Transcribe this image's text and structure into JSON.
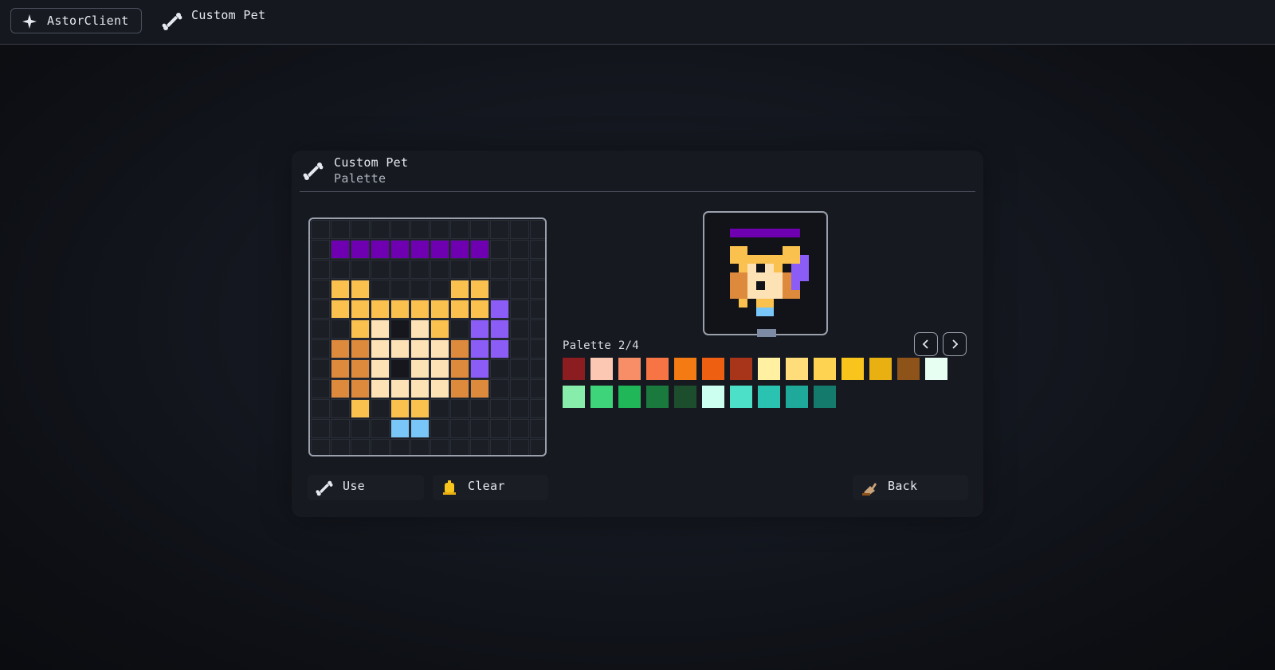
{
  "topbar": {
    "client_label": "AstorClient",
    "client_icon": "sparkle-icon",
    "breadcrumb_label": "Custom Pet",
    "breadcrumb_icon": "bone-icon"
  },
  "panel": {
    "title": "Custom Pet",
    "subtitle": "Palette",
    "icon": "bone-icon"
  },
  "palette": {
    "label": "Palette 2/4",
    "prev_icon": "chevron-left-icon",
    "next_icon": "chevron-right-icon",
    "colors": [
      "#8b1d20",
      "#fcc8b4",
      "#f88e67",
      "#f77545",
      "#f47a14",
      "#ef5f12",
      "#a8341a",
      "#fff0a2",
      "#fedd7a",
      "#fed352",
      "#f9c51c",
      "#e9b012",
      "#8e5318",
      "#e7fff3",
      "#86eeaa",
      "#3ed57a",
      "#1fb758",
      "#1a7a3d",
      "#1c4e2e",
      "#ccfff0",
      "#4de0c9",
      "#2ac3b2",
      "#1ea99a",
      "#147a6c"
    ]
  },
  "colors": {
    "purple": "#6f00b2",
    "violet": "#8b5cf6",
    "gold": "#fac14f",
    "cream": "#fde2b6",
    "orange": "#de8a3d",
    "blue": "#79c6f8",
    "dark": "#1b1e25",
    "outline": "#9aa0ac"
  },
  "pet_pixels": [
    "............",
    ".PPPPPPPP...",
    "............",
    ".GG....GG...",
    ".GGGGGGGGV..",
    "..GCDCG.VV..",
    ".OOCCCCOVV..",
    ".OOCDCCOV...",
    ".OOCCCCOO...",
    "..G.GG......",
    "....BB......",
    "............"
  ],
  "buttons": {
    "use_label": "Use",
    "use_icon": "bone-icon",
    "clear_label": "Clear",
    "clear_icon": "bell-icon",
    "back_label": "Back",
    "back_icon": "back-arrow-icon"
  }
}
